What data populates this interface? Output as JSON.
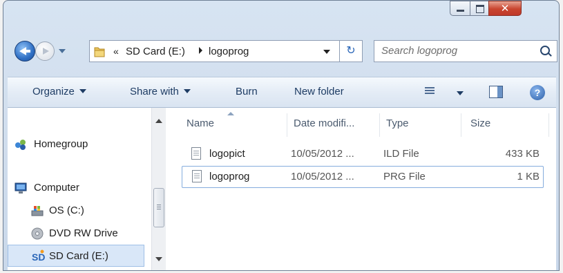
{
  "address": {
    "segments": [
      "SD Card (E:)",
      "logoprog"
    ]
  },
  "search": {
    "placeholder": "Search logoprog"
  },
  "toolbar": {
    "organize": "Organize",
    "share_with": "Share with",
    "burn": "Burn",
    "new_folder": "New folder"
  },
  "nav": {
    "homegroup": "Homegroup",
    "computer": "Computer",
    "drives": [
      "OS (C:)",
      "DVD RW Drive",
      "SD Card (E:)"
    ]
  },
  "columns": [
    "Name",
    "Date modifi...",
    "Type",
    "Size"
  ],
  "files": [
    {
      "name": "logopict",
      "date": "10/05/2012 ...",
      "type": "ILD File",
      "size": "433 KB"
    },
    {
      "name": "logoprog",
      "date": "10/05/2012 ...",
      "type": "PRG File",
      "size": "1 KB"
    }
  ],
  "colors": {
    "accent": "#2f6fc4",
    "selection": "#d9e7f8",
    "close": "#c9452f"
  },
  "icons": [
    "back-icon",
    "forward-icon",
    "folder-icon",
    "refresh-icon",
    "search-icon",
    "views-icon",
    "preview-pane-icon",
    "help-icon",
    "homegroup-icon",
    "computer-icon",
    "drive-icon",
    "dvd-icon",
    "sd-card-icon",
    "file-icon"
  ]
}
